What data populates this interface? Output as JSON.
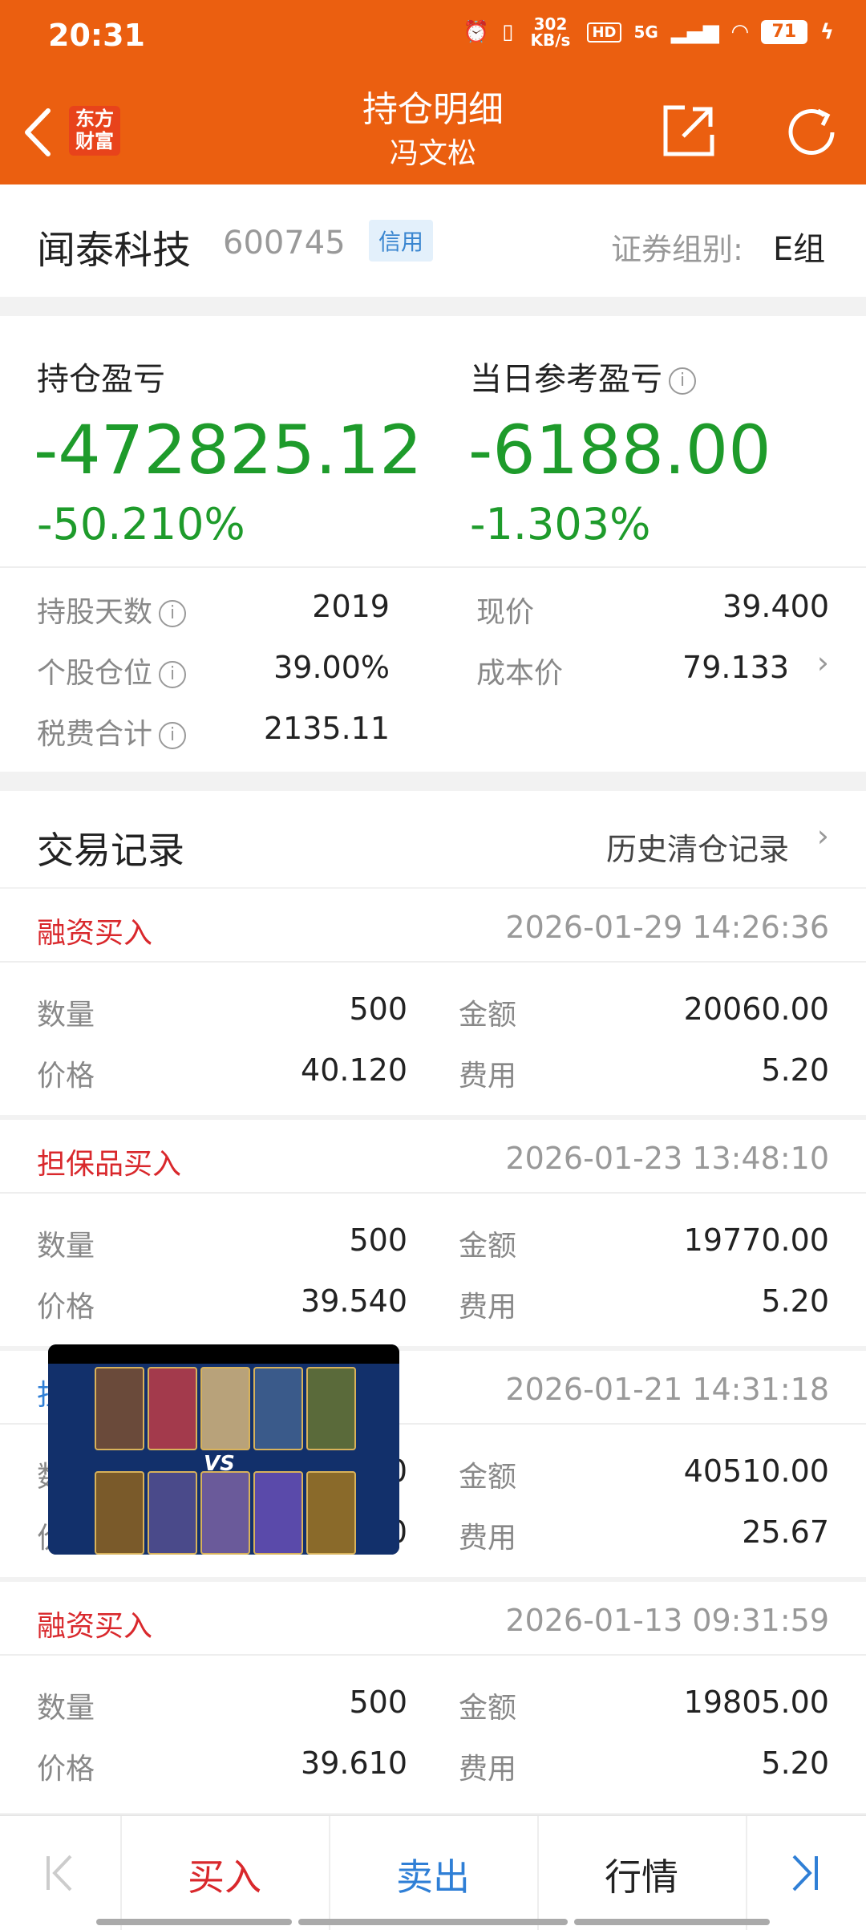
{
  "status": {
    "time": "20:31",
    "speed": "302 KB/s",
    "network": "5G",
    "battery": "71"
  },
  "header": {
    "title": "持仓明细",
    "subtitle": "冯文松",
    "logo_text": "东方财富"
  },
  "stock": {
    "name": "闻泰科技",
    "code": "600745",
    "tag": "信用",
    "group_label": "证券组别:",
    "group_value": "E组"
  },
  "summary": {
    "hold_pl_label": "持仓盈亏",
    "hold_pl_value": "-472825.12",
    "hold_pl_pct": "-50.210%",
    "day_pl_label": "当日参考盈亏",
    "day_pl_value": "-6188.00",
    "day_pl_pct": "-1.303%",
    "days_label": "持股天数",
    "days_value": "2019",
    "price_label": "现价",
    "price_value": "39.400",
    "position_label": "个股仓位",
    "position_value": "39.00%",
    "cost_label": "成本价",
    "cost_value": "79.133",
    "fee_label": "税费合计",
    "fee_value": "2135.11",
    "info_icon": "i"
  },
  "trades": {
    "title": "交易记录",
    "history_link": "历史清仓记录",
    "labels": {
      "qty": "数量",
      "amount": "金额",
      "price": "价格",
      "fee": "费用"
    },
    "items": [
      {
        "type": "融资买入",
        "time": "2026-01-29 14:26:36",
        "qty": "500",
        "amount": "20060.00",
        "price": "40.120",
        "fee": "5.20"
      },
      {
        "type": "担保品买入",
        "time": "2026-01-23 13:48:10",
        "qty": "500",
        "amount": "19770.00",
        "price": "39.540",
        "fee": "5.20"
      },
      {
        "type": "担",
        "time": "2026-01-21 14:31:18",
        "qty": "0",
        "amount": "40510.00",
        "price": "0",
        "fee": "25.67"
      },
      {
        "type": "融资买入",
        "time": "2026-01-13 09:31:59",
        "qty": "500",
        "amount": "19805.00",
        "price": "39.610",
        "fee": "5.20"
      }
    ]
  },
  "nav": {
    "buy": "买入",
    "sell": "卖出",
    "market": "行情"
  },
  "pip": {
    "vs": "VS"
  },
  "colors": {
    "header": "#eb5f10",
    "loss": "#1e9b2b",
    "trade_type": "#d9282c",
    "sell": "#2f7fd6"
  }
}
